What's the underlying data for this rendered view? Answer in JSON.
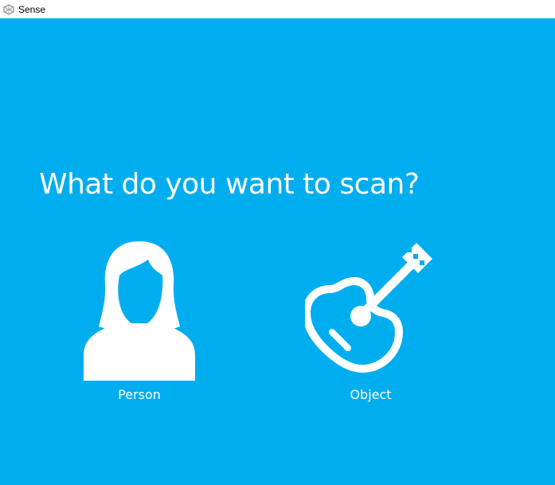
{
  "window": {
    "title": "Sense",
    "icon": "sense-app-icon"
  },
  "main": {
    "heading": "What do you want to scan?",
    "options": [
      {
        "label": "Person",
        "icon": "person-icon"
      },
      {
        "label": "Object",
        "icon": "guitar-icon"
      }
    ]
  },
  "colors": {
    "background": "#00aeef",
    "foreground": "#ffffff"
  }
}
